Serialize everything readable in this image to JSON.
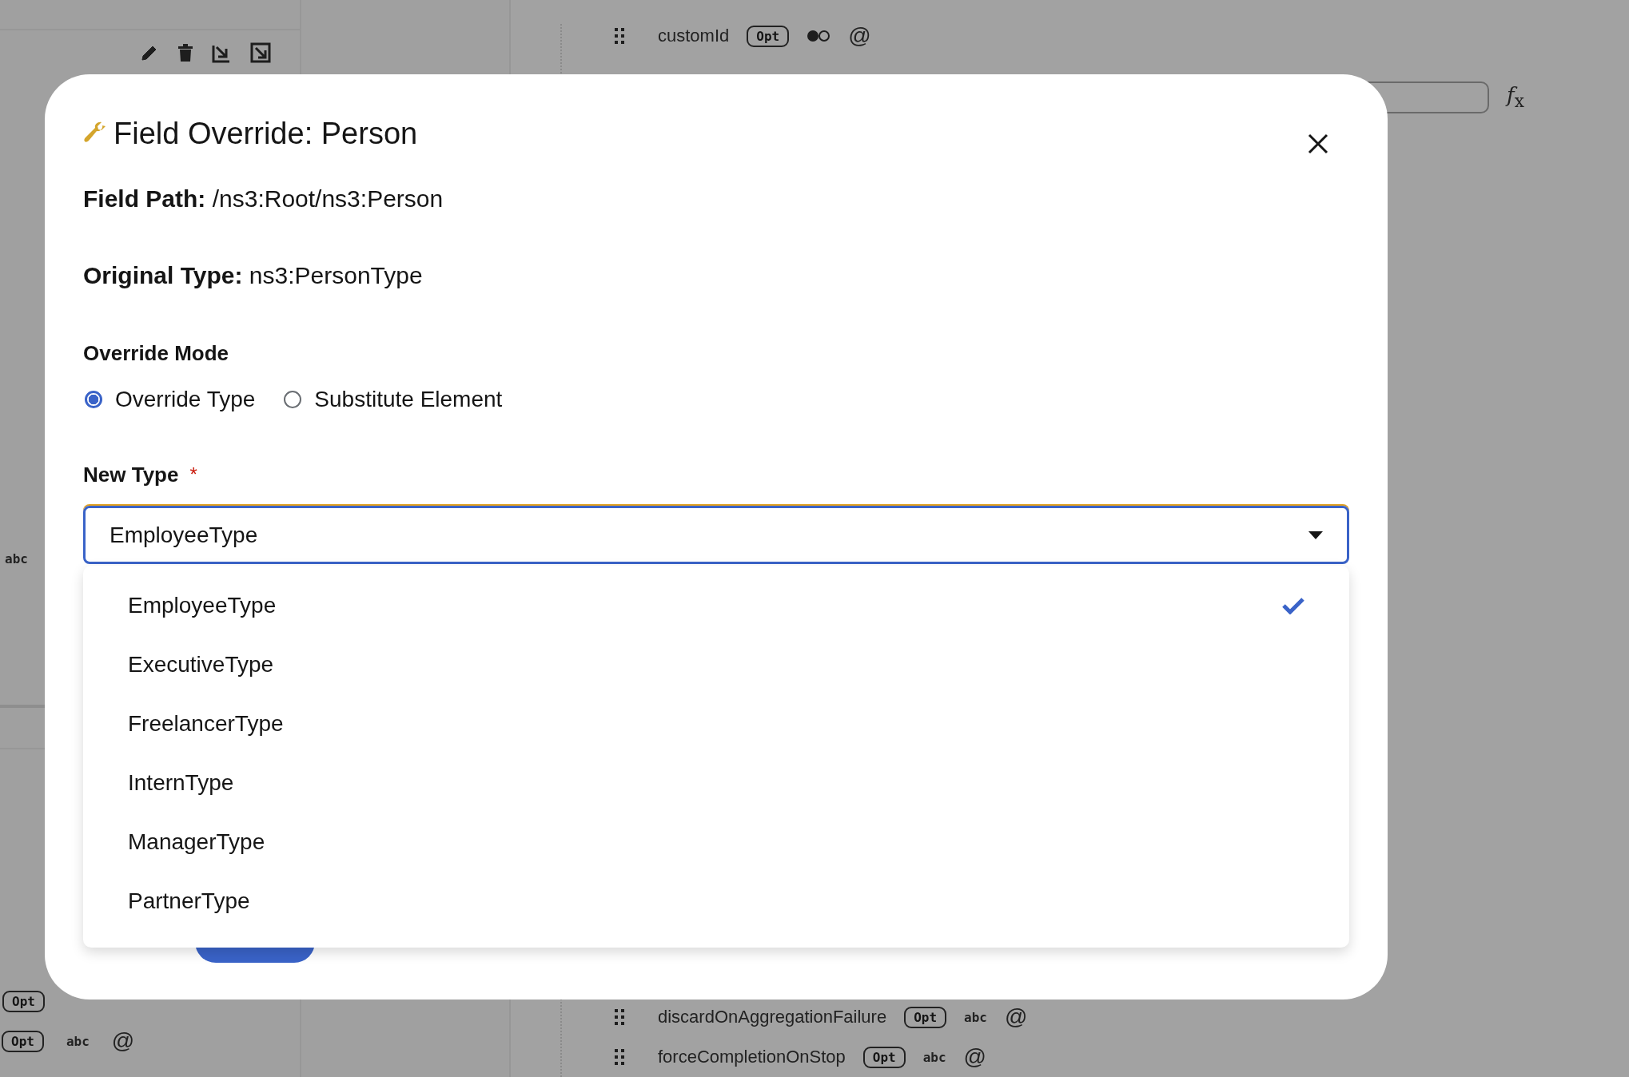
{
  "background": {
    "left_rows": [
      {
        "badge": "Opt",
        "type_text": "abc",
        "symbol": "@"
      }
    ],
    "left_note": "abc",
    "function_symbol": "*f*$_{x}$",
    "left_badge": "Opt",
    "right_rows_top": [
      {
        "name": "customId",
        "badge": "Opt",
        "kind": "boolean",
        "symbol": "@"
      }
    ],
    "right_rows_bottom": [
      {
        "name": "discardOnAggregationFailure",
        "badge": "Opt",
        "kind": "text",
        "type_text": "abc",
        "symbol": "@"
      },
      {
        "name": "forceCompletionOnStop",
        "badge": "Opt",
        "kind": "text",
        "type_text": "abc",
        "symbol": "@"
      }
    ]
  },
  "dialog": {
    "title": "Field Override: Person",
    "field_path": {
      "label": "Field Path:",
      "value": "/ns3:Root/ns3:Person"
    },
    "original_type": {
      "label": "Original Type:",
      "value": "ns3:PersonType"
    },
    "override_mode": {
      "label": "Override Mode",
      "options": [
        {
          "label": "Override Type",
          "selected": true
        },
        {
          "label": "Substitute Element",
          "selected": false
        }
      ]
    },
    "new_type": {
      "label": "New Type",
      "required_mark": "*",
      "value": "EmployeeType",
      "expanded": true,
      "options": [
        {
          "label": "EmployeeType",
          "selected": true
        },
        {
          "label": "ExecutiveType",
          "selected": false
        },
        {
          "label": "FreelancerType",
          "selected": false
        },
        {
          "label": "InternType",
          "selected": false
        },
        {
          "label": "ManagerType",
          "selected": false
        },
        {
          "label": "PartnerType",
          "selected": false
        }
      ]
    }
  }
}
